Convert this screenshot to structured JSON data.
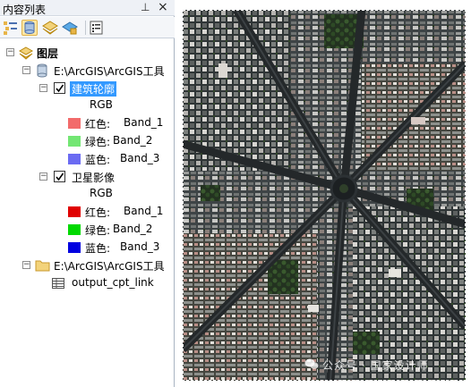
{
  "panel": {
    "title": "内容列表",
    "pin_glyph": "⊥",
    "close_glyph": "×"
  },
  "toolbar": {
    "buttons": [
      {
        "icon": "list-by-drawing-order-icon"
      },
      {
        "icon": "list-by-source-icon",
        "active": true
      },
      {
        "icon": "list-by-visibility-icon"
      },
      {
        "icon": "list-by-selection-icon"
      },
      {
        "icon": "options-icon"
      }
    ]
  },
  "tree": {
    "root_label": "图层",
    "db_label": "E:\\ArcGIS\\ArcGIS工具",
    "layer1": {
      "name": "建筑轮廓",
      "rgb_label": "RGB",
      "bands": [
        {
          "channel": "红色:",
          "band": "Band_1",
          "color": "#f26b6b"
        },
        {
          "channel": "绿色:",
          "band": "Band_2",
          "color": "#73e673"
        },
        {
          "channel": "蓝色:",
          "band": "Band_3",
          "color": "#6b6bf2"
        }
      ]
    },
    "layer2": {
      "name": "卫星影像",
      "rgb_label": "RGB",
      "bands": [
        {
          "channel": "红色:",
          "band": "Band_1",
          "color": "#e00000"
        },
        {
          "channel": "绿色:",
          "band": "Band_2",
          "color": "#00d900"
        },
        {
          "channel": "蓝色:",
          "band": "Band_3",
          "color": "#0000e0"
        }
      ]
    },
    "folder_label": "E:\\ArcGIS\\ArcGIS工具",
    "table_label": "output_cpt_link"
  },
  "watermark": {
    "text": "公众号 · 国家设计师"
  },
  "colors": {
    "selection": "#3399ff",
    "panel_header": "#eef1f6"
  }
}
